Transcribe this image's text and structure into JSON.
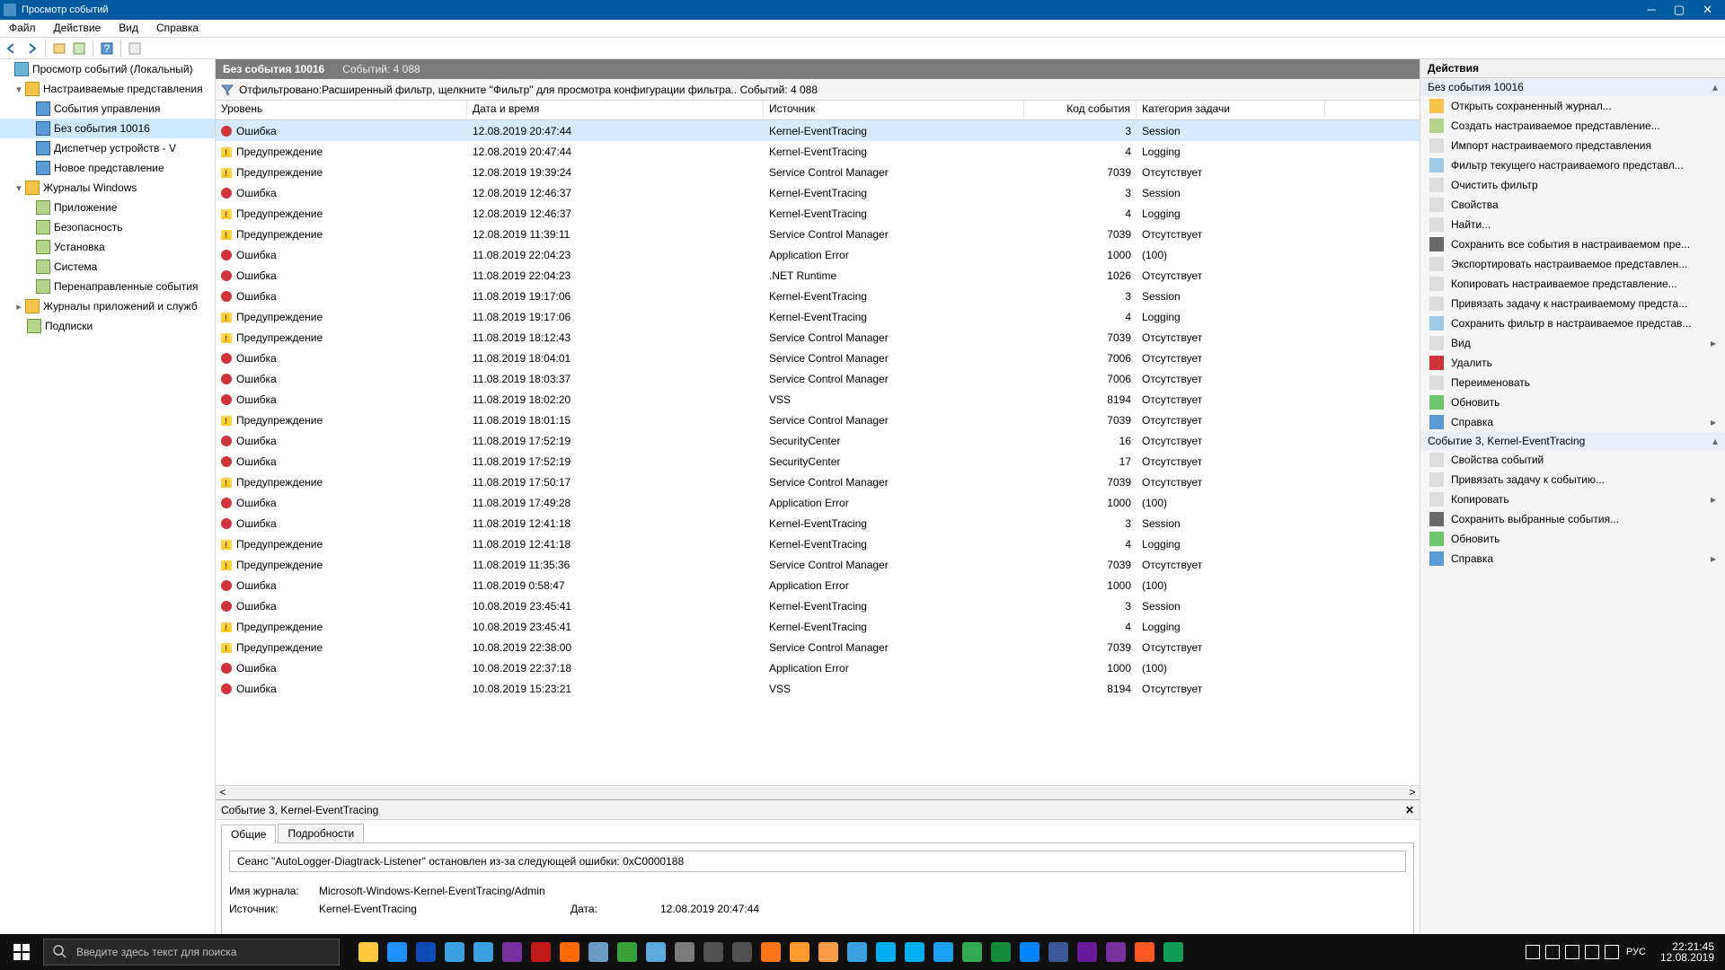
{
  "window": {
    "title": "Просмотр событий"
  },
  "menu": [
    "Файл",
    "Действие",
    "Вид",
    "Справка"
  ],
  "tree": {
    "root": "Просмотр событий (Локальный)",
    "custom_views": "Настраиваемые представления",
    "items": [
      "События управления",
      "Без события 10016",
      "Диспетчер устройств - V",
      "Новое представление"
    ],
    "win_logs": "Журналы Windows",
    "win_items": [
      "Приложение",
      "Безопасность",
      "Установка",
      "Система",
      "Перенаправленные события"
    ],
    "app_logs": "Журналы приложений и служб",
    "subs": "Подписки"
  },
  "view_header": {
    "title": "Без события 10016",
    "count": "Событий: 4 088"
  },
  "filter_bar": "Отфильтровано:Расширенный фильтр, щелкните \"Фильтр\" для просмотра конфигурации фильтра.. Событий: 4 088",
  "columns": {
    "level": "Уровень",
    "datetime": "Дата и время",
    "source": "Источник",
    "code": "Код события",
    "category": "Категория задачи"
  },
  "events": [
    {
      "lvl": "error",
      "dt": "12.08.2019 20:47:44",
      "src": "Kernel-EventTracing",
      "code": "3",
      "cat": "Session"
    },
    {
      "lvl": "warn",
      "dt": "12.08.2019 20:47:44",
      "src": "Kernel-EventTracing",
      "code": "4",
      "cat": "Logging"
    },
    {
      "lvl": "warn",
      "dt": "12.08.2019 19:39:24",
      "src": "Service Control Manager",
      "code": "7039",
      "cat": "Отсутствует"
    },
    {
      "lvl": "error",
      "dt": "12.08.2019 12:46:37",
      "src": "Kernel-EventTracing",
      "code": "3",
      "cat": "Session"
    },
    {
      "lvl": "warn",
      "dt": "12.08.2019 12:46:37",
      "src": "Kernel-EventTracing",
      "code": "4",
      "cat": "Logging"
    },
    {
      "lvl": "warn",
      "dt": "12.08.2019 11:39:11",
      "src": "Service Control Manager",
      "code": "7039",
      "cat": "Отсутствует"
    },
    {
      "lvl": "error",
      "dt": "11.08.2019 22:04:23",
      "src": "Application Error",
      "code": "1000",
      "cat": "(100)"
    },
    {
      "lvl": "error",
      "dt": "11.08.2019 22:04:23",
      "src": ".NET Runtime",
      "code": "1026",
      "cat": "Отсутствует"
    },
    {
      "lvl": "error",
      "dt": "11.08.2019 19:17:06",
      "src": "Kernel-EventTracing",
      "code": "3",
      "cat": "Session"
    },
    {
      "lvl": "warn",
      "dt": "11.08.2019 19:17:06",
      "src": "Kernel-EventTracing",
      "code": "4",
      "cat": "Logging"
    },
    {
      "lvl": "warn",
      "dt": "11.08.2019 18:12:43",
      "src": "Service Control Manager",
      "code": "7039",
      "cat": "Отсутствует"
    },
    {
      "lvl": "error",
      "dt": "11.08.2019 18:04:01",
      "src": "Service Control Manager",
      "code": "7006",
      "cat": "Отсутствует"
    },
    {
      "lvl": "error",
      "dt": "11.08.2019 18:03:37",
      "src": "Service Control Manager",
      "code": "7006",
      "cat": "Отсутствует"
    },
    {
      "lvl": "error",
      "dt": "11.08.2019 18:02:20",
      "src": "VSS",
      "code": "8194",
      "cat": "Отсутствует"
    },
    {
      "lvl": "warn",
      "dt": "11.08.2019 18:01:15",
      "src": "Service Control Manager",
      "code": "7039",
      "cat": "Отсутствует"
    },
    {
      "lvl": "error",
      "dt": "11.08.2019 17:52:19",
      "src": "SecurityCenter",
      "code": "16",
      "cat": "Отсутствует"
    },
    {
      "lvl": "error",
      "dt": "11.08.2019 17:52:19",
      "src": "SecurityCenter",
      "code": "17",
      "cat": "Отсутствует"
    },
    {
      "lvl": "warn",
      "dt": "11.08.2019 17:50:17",
      "src": "Service Control Manager",
      "code": "7039",
      "cat": "Отсутствует"
    },
    {
      "lvl": "error",
      "dt": "11.08.2019 17:49:28",
      "src": "Application Error",
      "code": "1000",
      "cat": "(100)"
    },
    {
      "lvl": "error",
      "dt": "11.08.2019 12:41:18",
      "src": "Kernel-EventTracing",
      "code": "3",
      "cat": "Session"
    },
    {
      "lvl": "warn",
      "dt": "11.08.2019 12:41:18",
      "src": "Kernel-EventTracing",
      "code": "4",
      "cat": "Logging"
    },
    {
      "lvl": "warn",
      "dt": "11.08.2019 11:35:36",
      "src": "Service Control Manager",
      "code": "7039",
      "cat": "Отсутствует"
    },
    {
      "lvl": "error",
      "dt": "11.08.2019 0:58:47",
      "src": "Application Error",
      "code": "1000",
      "cat": "(100)"
    },
    {
      "lvl": "error",
      "dt": "10.08.2019 23:45:41",
      "src": "Kernel-EventTracing",
      "code": "3",
      "cat": "Session"
    },
    {
      "lvl": "warn",
      "dt": "10.08.2019 23:45:41",
      "src": "Kernel-EventTracing",
      "code": "4",
      "cat": "Logging"
    },
    {
      "lvl": "warn",
      "dt": "10.08.2019 22:38:00",
      "src": "Service Control Manager",
      "code": "7039",
      "cat": "Отсутствует"
    },
    {
      "lvl": "error",
      "dt": "10.08.2019 22:37:18",
      "src": "Application Error",
      "code": "1000",
      "cat": "(100)"
    },
    {
      "lvl": "error",
      "dt": "10.08.2019 15:23:21",
      "src": "VSS",
      "code": "8194",
      "cat": "Отсутствует"
    }
  ],
  "levels": {
    "error": "Ошибка",
    "warn": "Предупреждение"
  },
  "detail": {
    "header": "Событие 3, Kernel-EventTracing",
    "tabs": [
      "Общие",
      "Подробности"
    ],
    "message": "Сеанс \"AutoLogger-Diagtrack-Listener\" остановлен из-за следующей ошибки: 0xC0000188",
    "log_name_lbl": "Имя журнала:",
    "log_name_val": "Microsoft-Windows-Kernel-EventTracing/Admin",
    "source_lbl": "Источник:",
    "source_val": "Kernel-EventTracing",
    "date_lbl": "Дата:",
    "date_val": "12.08.2019 20:47:44"
  },
  "actions": {
    "title": "Действия",
    "group1": "Без события 10016",
    "items1": [
      {
        "ico": "open",
        "label": "Открыть сохраненный журнал..."
      },
      {
        "ico": "create",
        "label": "Создать настраиваемое представление..."
      },
      {
        "ico": "import",
        "label": "Импорт настраиваемого представления"
      },
      {
        "ico": "filter",
        "label": "Фильтр текущего настраиваемого представл..."
      },
      {
        "ico": "clear",
        "label": "Очистить фильтр"
      },
      {
        "ico": "props",
        "label": "Свойства"
      },
      {
        "ico": "find",
        "label": "Найти..."
      },
      {
        "ico": "save",
        "label": "Сохранить все события в настраиваемом пре..."
      },
      {
        "ico": "export",
        "label": "Экспортировать настраиваемое представлен..."
      },
      {
        "ico": "copy",
        "label": "Копировать настраиваемое представление..."
      },
      {
        "ico": "attach",
        "label": "Привязать задачу к настраиваемому предста..."
      },
      {
        "ico": "savefilter",
        "label": "Сохранить фильтр в настраиваемое представ..."
      },
      {
        "ico": "view",
        "label": "Вид",
        "arrow": true
      },
      {
        "ico": "delete",
        "label": "Удалить"
      },
      {
        "ico": "rename",
        "label": "Переименовать"
      },
      {
        "ico": "refresh",
        "label": "Обновить"
      },
      {
        "ico": "help",
        "label": "Справка",
        "arrow": true
      }
    ],
    "group2": "Событие 3, Kernel-EventTracing",
    "items2": [
      {
        "ico": "evtprops",
        "label": "Свойства событий"
      },
      {
        "ico": "attach",
        "label": "Привязать задачу к событию..."
      },
      {
        "ico": "copy",
        "label": "Копировать",
        "arrow": true
      },
      {
        "ico": "save",
        "label": "Сохранить выбранные события..."
      },
      {
        "ico": "refresh",
        "label": "Обновить"
      },
      {
        "ico": "help",
        "label": "Справка",
        "arrow": true
      }
    ]
  },
  "taskbar": {
    "search_placeholder": "Введите здесь текст для поиска",
    "lang": "РУС",
    "time": "22:21:45",
    "date": "12.08.2019"
  }
}
